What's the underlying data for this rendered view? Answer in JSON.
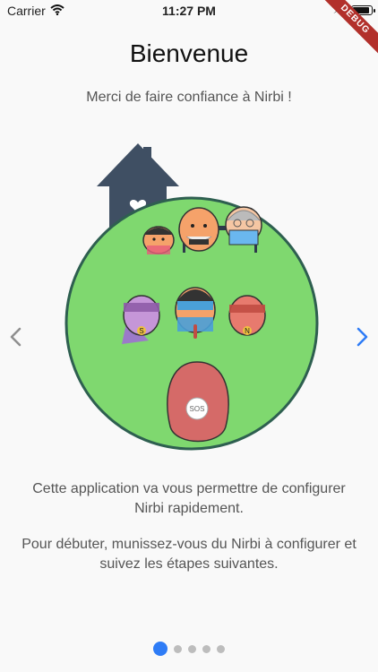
{
  "status": {
    "carrier": "Carrier",
    "time": "11:27 PM",
    "battery_level": 0.95
  },
  "debug_banner": "DEBUG",
  "page": {
    "title": "Bienvenue",
    "subtitle": "Merci de faire confiance à Nirbi !",
    "paragraph1": "Cette application va vous permettre de configurer Nirbi rapidement.",
    "paragraph2": "Pour débuter, munissez-vous du Nirbi à configurer et suivez les étapes suivantes."
  },
  "illustration": {
    "hero_badges": [
      "S",
      "N"
    ],
    "device_label": "SOS"
  },
  "pager": {
    "total": 5,
    "current": 1
  },
  "colors": {
    "accent": "#2e7cf6",
    "circle": "#7fd86f",
    "house": "#3f4f63",
    "debug": "#b2302b"
  }
}
